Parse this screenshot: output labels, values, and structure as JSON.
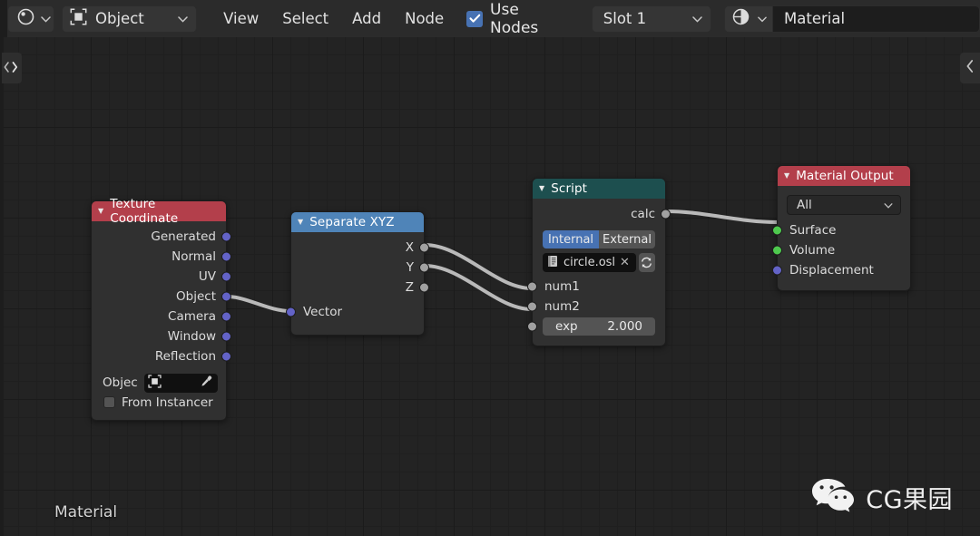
{
  "header": {
    "editor_type_icon": "shading-editor-icon",
    "editor_type_chevron": "chevron-down-icon",
    "shader_type_icon": "object-shader-icon",
    "shader_type_label": "Object",
    "shader_type_chevron": "chevron-down-icon",
    "menus": [
      "View",
      "Select",
      "Add",
      "Node"
    ],
    "use_nodes": {
      "label": "Use Nodes",
      "checked": true,
      "check_color": "#4772b3"
    },
    "slot": {
      "label": "Slot 1",
      "chevron": "chevron-down-icon"
    },
    "material": {
      "icon": "material-sphere-icon",
      "chevron": "chevron-down-icon",
      "name": "Material"
    }
  },
  "canvas": {
    "left_toggle_icon": "chevron-left-right-icon",
    "right_toggle_icon": "chevron-left-icon",
    "footer_label": "Material",
    "watermark": {
      "icon": "wechat-icon",
      "text": "CG果园"
    }
  },
  "nodes": {
    "texture_coordinate": {
      "title": "Texture Coordinate",
      "header_color": "#b33f4b",
      "collapse_icon": "triangle-down-icon",
      "outputs": [
        {
          "label": "Generated",
          "socket": "vector"
        },
        {
          "label": "Normal",
          "socket": "vector"
        },
        {
          "label": "UV",
          "socket": "vector"
        },
        {
          "label": "Object",
          "socket": "vector"
        },
        {
          "label": "Camera",
          "socket": "vector"
        },
        {
          "label": "Window",
          "socket": "vector"
        },
        {
          "label": "Reflection",
          "socket": "vector"
        }
      ],
      "object_field": {
        "label": "Objec",
        "value": "",
        "icon": "object-shader-icon",
        "eyedropper_icon": "eyedropper-icon"
      },
      "from_instancer": {
        "label": "From Instancer",
        "checked": false
      }
    },
    "separate_xyz": {
      "title": "Separate XYZ",
      "header_color": "#4f84b8",
      "collapse_icon": "triangle-down-icon",
      "outputs": [
        {
          "label": "X",
          "socket": "gray"
        },
        {
          "label": "Y",
          "socket": "gray"
        },
        {
          "label": "Z",
          "socket": "gray"
        }
      ],
      "inputs": [
        {
          "label": "Vector",
          "socket": "vector"
        }
      ]
    },
    "script": {
      "title": "Script",
      "header_color": "#1d4f4f",
      "collapse_icon": "triangle-down-icon",
      "outputs": [
        {
          "label": "calc",
          "socket": "gray"
        }
      ],
      "mode_toggle": {
        "options": [
          "Internal",
          "External"
        ],
        "selected": "Internal"
      },
      "file_field": {
        "icon": "text-datablock-icon",
        "name": "circle.osl",
        "clear_icon": "close-x-icon",
        "refresh_icon": "refresh-icon"
      },
      "inputs": [
        {
          "label": "num1",
          "socket": "gray"
        },
        {
          "label": "num2",
          "socket": "gray"
        }
      ],
      "value_field": {
        "label": "exp",
        "value": "2.000",
        "socket": "gray"
      }
    },
    "material_output": {
      "title": "Material Output",
      "header_color": "#b33f4b",
      "collapse_icon": "triangle-down-icon",
      "target": {
        "value": "All",
        "chevron": "chevron-down-icon"
      },
      "inputs": [
        {
          "label": "Surface",
          "socket": "green"
        },
        {
          "label": "Volume",
          "socket": "green"
        },
        {
          "label": "Displacement",
          "socket": "vector"
        }
      ]
    }
  },
  "links": [
    {
      "from": "texture_coordinate.Object",
      "to": "separate_xyz.Vector"
    },
    {
      "from": "separate_xyz.X",
      "to": "script.num1"
    },
    {
      "from": "separate_xyz.Y",
      "to": "script.num2"
    },
    {
      "from": "script.calc",
      "to": "material_output.Surface"
    }
  ],
  "colors": {
    "background": "#232323",
    "node_body": "#303030",
    "accent_blue": "#4772b3",
    "socket_vector": "#6363c7",
    "socket_gray": "#a1a1a1",
    "socket_shader": "#4ec94e"
  }
}
